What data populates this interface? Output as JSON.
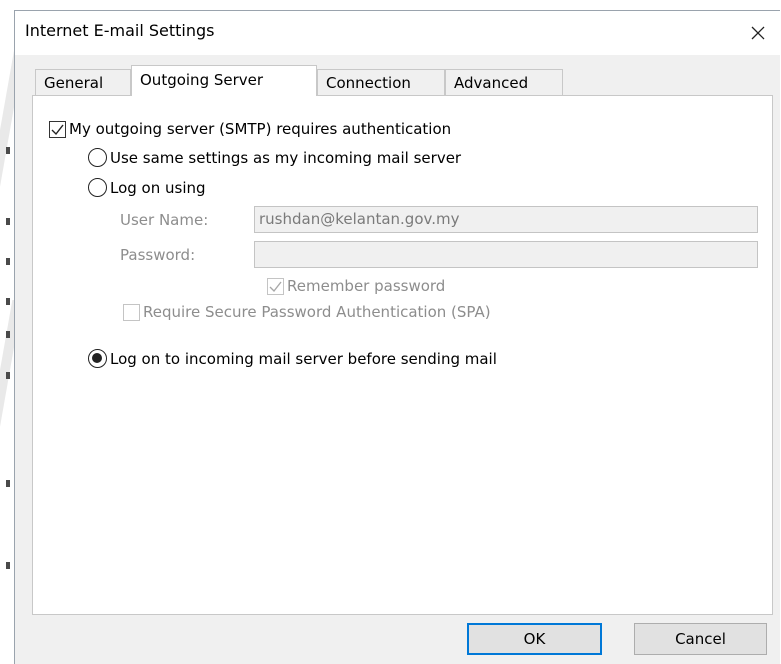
{
  "window": {
    "title": "Internet E-mail Settings"
  },
  "tabs": [
    {
      "label": "General",
      "active": false
    },
    {
      "label": "Outgoing Server",
      "active": true
    },
    {
      "label": "Connection",
      "active": false
    },
    {
      "label": "Advanced",
      "active": false
    }
  ],
  "outgoing": {
    "auth_required_label": "My outgoing server (SMTP) requires authentication",
    "auth_required_checked": true,
    "same_settings_label": "Use same settings as my incoming mail server",
    "log_on_using_label": "Log on using",
    "user_name_label": "User Name:",
    "user_name_value": "rushdan@kelantan.gov.my",
    "password_label": "Password:",
    "password_value": "",
    "remember_password_label": "Remember password",
    "remember_password_checked": true,
    "spa_label": "Require Secure Password Authentication (SPA)",
    "spa_checked": false,
    "log_on_incoming_label": "Log on to incoming mail server before sending mail",
    "selected_option": "log_on_incoming"
  },
  "buttons": {
    "ok_label": "OK",
    "cancel_label": "Cancel"
  },
  "colors": {
    "dialog_bg": "#f0f0f0",
    "panel_bg": "#ffffff",
    "primary_border": "#0078d7",
    "disabled_text": "#8d8d8d"
  }
}
